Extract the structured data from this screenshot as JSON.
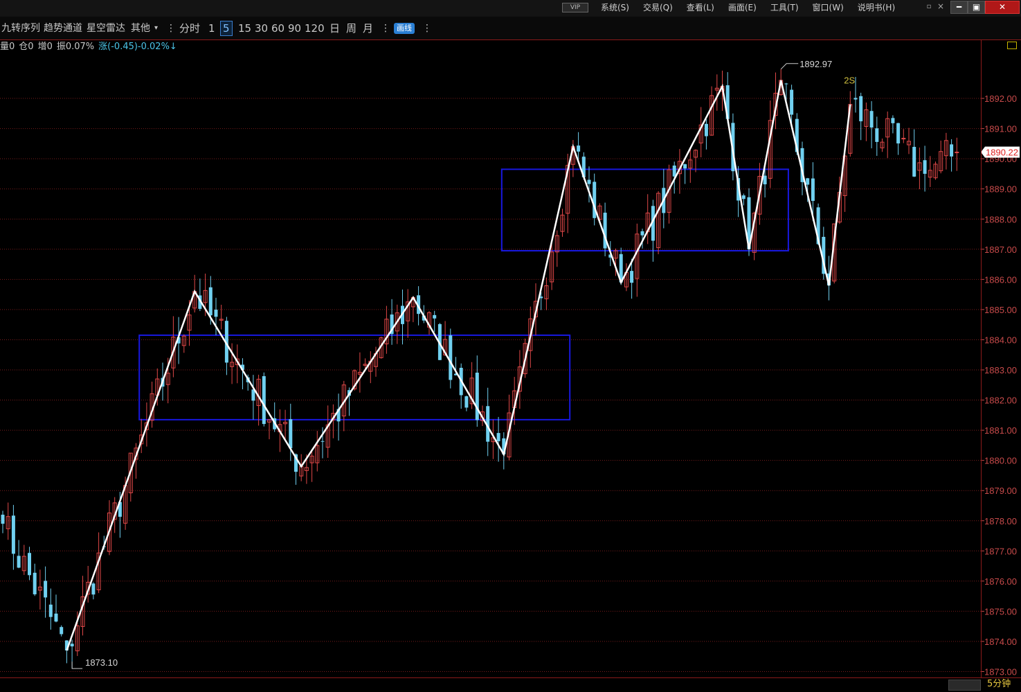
{
  "window": {
    "vip_label": "VIP",
    "menu": [
      "系统(S)",
      "交易(Q)",
      "查看(L)",
      "画面(E)",
      "工具(T)",
      "窗口(W)",
      "说明书(H)"
    ],
    "controls": {
      "restore": "▫",
      "close_small": "×",
      "minimize": "━",
      "maximize": "▣",
      "close": "✕"
    }
  },
  "toolbar": {
    "indicators": [
      "九转序列",
      "趋势通道",
      "星空雷达",
      "其他"
    ],
    "dropdown": "▾",
    "separator": "⋮",
    "periods": [
      "分时",
      "1",
      "5",
      "15",
      "30",
      "60",
      "90",
      "120",
      "日",
      "周",
      "月"
    ],
    "active_period": "5",
    "draw_button": "画线"
  },
  "info_bar": {
    "volume": "量0",
    "position": "仓0",
    "increase": "增0",
    "amplitude": "振0.07%",
    "change": "涨(-0.45)-0.02%↓"
  },
  "bottom": {
    "period_label": "5分钟"
  },
  "colors": {
    "grid": "#7a1c1c",
    "axis_text": "#c84a4a",
    "up": "#e04848",
    "down": "#70d0f0",
    "zigzag": "#ffffff",
    "box": "#1818e0",
    "last_price_bg": "#ffffff",
    "last_price_text": "#e02020",
    "annotation": "#d0c040"
  },
  "chart_data": {
    "type": "candlestick",
    "ylim": [
      1873.0,
      1893.6
    ],
    "y_ticks": [
      "1873.00",
      "1874.00",
      "1875.00",
      "1876.00",
      "1877.00",
      "1878.00",
      "1879.00",
      "1880.00",
      "1881.00",
      "1882.00",
      "1883.00",
      "1884.00",
      "1885.00",
      "1886.00",
      "1887.00",
      "1888.00",
      "1889.00",
      "1890.00",
      "1891.00",
      "1892.00"
    ],
    "last_price": "1890.22",
    "high_label": "1892.97",
    "low_label": "1873.10",
    "signal_label": "2S",
    "bar_count": 180,
    "pivots": [
      {
        "i": 0,
        "p": 1877.9
      },
      {
        "i": 12,
        "p": 1873.7
      },
      {
        "i": 36,
        "p": 1885.6
      },
      {
        "i": 56,
        "p": 1879.8
      },
      {
        "i": 77,
        "p": 1885.4
      },
      {
        "i": 94,
        "p": 1880.2
      },
      {
        "i": 107,
        "p": 1890.4
      },
      {
        "i": 116,
        "p": 1885.9
      },
      {
        "i": 135,
        "p": 1892.4
      },
      {
        "i": 140,
        "p": 1887.0
      },
      {
        "i": 146,
        "p": 1892.6
      },
      {
        "i": 155,
        "p": 1885.8
      },
      {
        "i": 159,
        "p": 1891.8
      },
      {
        "i": 173,
        "p": 1889.5
      },
      {
        "i": 179,
        "p": 1890.22
      }
    ],
    "zigzag": [
      {
        "i": 12,
        "p": 1873.7
      },
      {
        "i": 36,
        "p": 1885.6
      },
      {
        "i": 56,
        "p": 1879.8
      },
      {
        "i": 77,
        "p": 1885.4
      },
      {
        "i": 94,
        "p": 1880.2
      },
      {
        "i": 107,
        "p": 1890.4
      },
      {
        "i": 116,
        "p": 1885.9
      },
      {
        "i": 135,
        "p": 1892.4
      },
      {
        "i": 140,
        "p": 1887.0
      },
      {
        "i": 146,
        "p": 1892.6
      },
      {
        "i": 155,
        "p": 1885.8
      },
      {
        "i": 159,
        "p": 1891.8
      }
    ],
    "boxes": [
      {
        "i0": 26,
        "i1": 106,
        "p_low": 1881.35,
        "p_high": 1884.15
      },
      {
        "i0": 94,
        "i1": 147,
        "p_low": 1886.95,
        "p_high": 1889.65
      }
    ],
    "high_bar": 146,
    "low_bar": 13
  }
}
